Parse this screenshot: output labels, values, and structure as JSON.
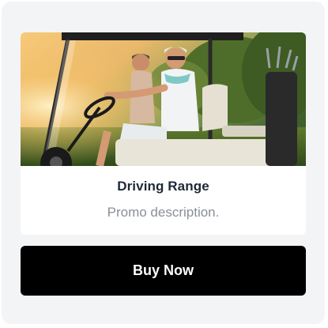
{
  "promo": {
    "title": "Driving Range",
    "description": "Promo description.",
    "image_label": "golf-cart-photo"
  },
  "actions": {
    "buy_label": "Buy Now"
  },
  "colors": {
    "panel_bg": "#f3f4f6",
    "card_bg": "#ffffff",
    "button_bg": "#000000",
    "button_text": "#ffffff",
    "title_text": "#1f2937",
    "desc_text": "#8a8f98"
  }
}
